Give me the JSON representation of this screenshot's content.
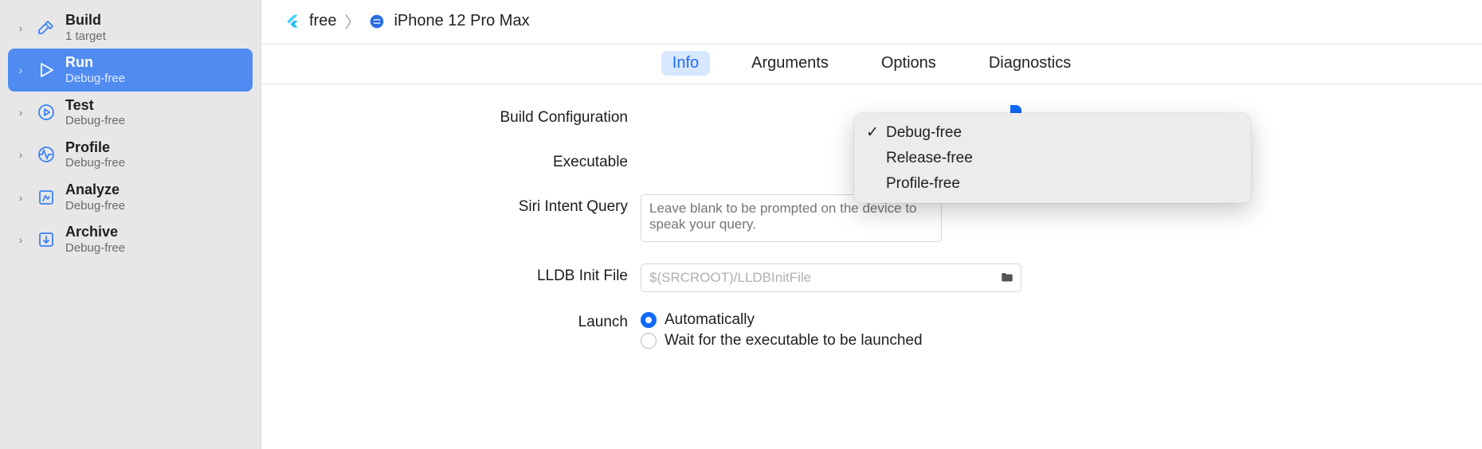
{
  "sidebar": {
    "items": [
      {
        "title": "Build",
        "subtitle": "1 target"
      },
      {
        "title": "Run",
        "subtitle": "Debug-free"
      },
      {
        "title": "Test",
        "subtitle": "Debug-free"
      },
      {
        "title": "Profile",
        "subtitle": "Debug-free"
      },
      {
        "title": "Analyze",
        "subtitle": "Debug-free"
      },
      {
        "title": "Archive",
        "subtitle": "Debug-free"
      }
    ],
    "selected_index": 1
  },
  "breadcrumb": {
    "scheme": "free",
    "device": "iPhone 12 Pro Max"
  },
  "tabs": {
    "items": [
      "Info",
      "Arguments",
      "Options",
      "Diagnostics"
    ],
    "active_index": 0
  },
  "form": {
    "build_configuration_label": "Build Configuration",
    "executable_label": "Executable",
    "siri_label": "Siri Intent Query",
    "siri_placeholder": "Leave blank to be prompted on the device to speak your query.",
    "siri_value": "",
    "lldb_label": "LLDB Init File",
    "lldb_placeholder": "$(SRCROOT)/LLDBInitFile",
    "lldb_value": "",
    "launch_label": "Launch",
    "launch_options": [
      "Automatically",
      "Wait for the executable to be launched"
    ],
    "launch_selected_index": 0
  },
  "dropdown": {
    "options": [
      "Debug-free",
      "Release-free",
      "Profile-free"
    ],
    "selected_index": 0
  }
}
